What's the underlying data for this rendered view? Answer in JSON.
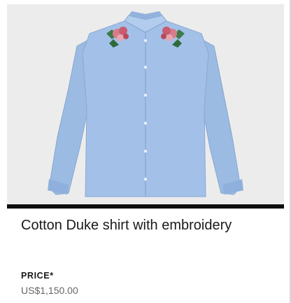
{
  "product": {
    "image_icon": "blue-shirt-with-floral-embroidery",
    "title": "Cotton Duke shirt with embroidery",
    "price_label": "PRICE*",
    "price": "US$1,150.00"
  },
  "colors": {
    "shirt": "#9fbfe6",
    "image_background": "#ececec",
    "divider": "#0e0e0e",
    "price_text": "#666666"
  }
}
